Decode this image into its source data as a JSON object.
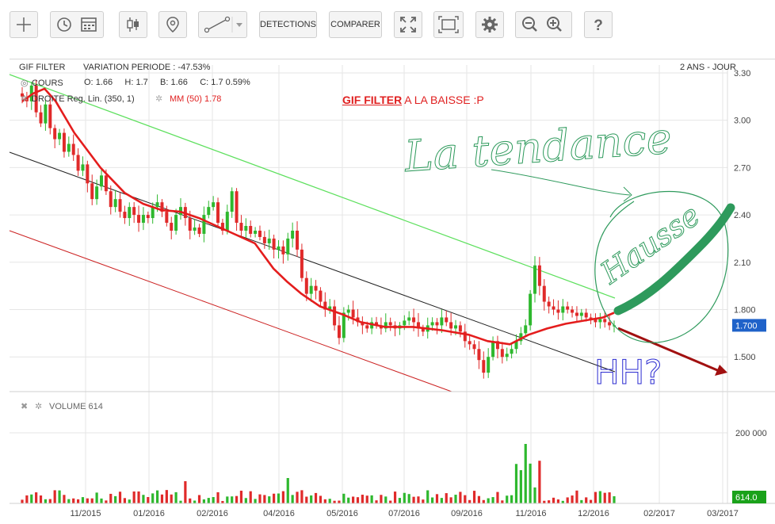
{
  "toolbar": {
    "detections_label": "DETECTIONS",
    "comparer_label": "COMPARER"
  },
  "header": {
    "instrument": "GIF FILTER",
    "variation_label": "VARIATION PERIODE :",
    "variation_value": "-47.53%",
    "period": "2 ANS - JOUR",
    "cours_label": "COURS",
    "o_label": "O:",
    "o_value": "1.66",
    "h_label": "H:",
    "h_value": "1.7",
    "b_label": "B:",
    "b_value": "1.66",
    "c_label": "C:",
    "c_value": "1.7 0.59%",
    "droite_label": "DROITE",
    "droite_value": "Reg. Lin. (350, 1)",
    "mm_label": "MM (50)",
    "mm_value": "1.78"
  },
  "annotation": {
    "title_bold": "GIF FILTER",
    "title_rest": " A LA BAISSE  :P",
    "handwritten_1": "La tendance",
    "handwritten_2": "Hausse",
    "handwritten_3": "HH?"
  },
  "volume": {
    "label": "VOLUME",
    "value": "614"
  },
  "colors": {
    "up": "#2eb82e",
    "down": "#e02a2a",
    "ma": "#e41d1d",
    "upper_channel": "#5ee05e",
    "lower_channel": "#cc2222",
    "regression": "#222222",
    "price_badge": "#1f62c9",
    "volume_badge": "#1aa21a",
    "handwriting": "#2e9a5c"
  },
  "chart_data": {
    "type": "candlestick",
    "x_ticks": [
      "11/2015",
      "01/2016",
      "02/2016",
      "04/2016",
      "05/2016",
      "07/2016",
      "09/2016",
      "11/2016",
      "12/2016",
      "02/2017",
      "03/2017"
    ],
    "y_ticks": [
      "3.30",
      "3.00",
      "2.70",
      "2.40",
      "2.10",
      "1.800",
      "1.500"
    ],
    "ylim": [
      1.28,
      3.35
    ],
    "last_price": "1.700",
    "last_volume": "614.0",
    "volume_ticks": [
      "200 000"
    ],
    "ma50_path": [
      [
        0,
        3.12
      ],
      [
        6,
        3.17
      ],
      [
        12,
        3.2
      ],
      [
        18,
        3.12
      ],
      [
        28,
        2.92
      ],
      [
        42,
        2.7
      ],
      [
        55,
        2.54
      ],
      [
        65,
        2.47
      ],
      [
        75,
        2.43
      ],
      [
        85,
        2.42
      ],
      [
        95,
        2.38
      ],
      [
        110,
        2.3
      ],
      [
        125,
        2.22
      ],
      [
        135,
        2.06
      ],
      [
        142,
        1.98
      ],
      [
        150,
        1.9
      ],
      [
        160,
        1.82
      ],
      [
        172,
        1.77
      ],
      [
        182,
        1.72
      ],
      [
        195,
        1.69
      ],
      [
        210,
        1.69
      ],
      [
        225,
        1.67
      ],
      [
        240,
        1.64
      ],
      [
        250,
        1.6
      ],
      [
        262,
        1.58
      ],
      [
        272,
        1.64
      ],
      [
        282,
        1.68
      ],
      [
        292,
        1.71
      ],
      [
        302,
        1.73
      ],
      [
        312,
        1.75
      ],
      [
        318,
        1.78
      ]
    ],
    "candles": [
      {
        "c": 3.15
      },
      {
        "c": 3.12
      },
      {
        "c": 3.22
      },
      {
        "c": 3.05
      },
      {
        "c": 2.98
      },
      {
        "c": 3.1
      },
      {
        "c": 2.95
      },
      {
        "c": 2.88
      },
      {
        "c": 2.92
      },
      {
        "c": 2.8
      },
      {
        "c": 2.85
      },
      {
        "c": 2.78
      },
      {
        "c": 2.68
      },
      {
        "c": 2.72
      },
      {
        "c": 2.6
      },
      {
        "c": 2.5
      },
      {
        "c": 2.58
      },
      {
        "c": 2.65
      },
      {
        "c": 2.55
      },
      {
        "c": 2.45
      },
      {
        "c": 2.5
      },
      {
        "c": 2.42
      },
      {
        "c": 2.38
      },
      {
        "c": 2.45
      },
      {
        "c": 2.4
      },
      {
        "c": 2.35
      },
      {
        "c": 2.4
      },
      {
        "c": 2.38
      },
      {
        "c": 2.45
      },
      {
        "c": 2.48
      },
      {
        "c": 2.42
      },
      {
        "c": 2.35
      },
      {
        "c": 2.3
      },
      {
        "c": 2.4
      },
      {
        "c": 2.45
      },
      {
        "c": 2.38
      },
      {
        "c": 2.3
      },
      {
        "c": 2.32
      },
      {
        "c": 2.28
      },
      {
        "c": 2.4
      },
      {
        "c": 2.45
      },
      {
        "c": 2.48
      },
      {
        "c": 2.35
      },
      {
        "c": 2.3
      },
      {
        "c": 2.42
      },
      {
        "c": 2.55
      },
      {
        "c": 2.35
      },
      {
        "c": 2.3
      },
      {
        "c": 2.33
      },
      {
        "c": 2.28
      },
      {
        "c": 2.3
      },
      {
        "c": 2.26
      },
      {
        "c": 2.22
      },
      {
        "c": 2.25
      },
      {
        "c": 2.18
      },
      {
        "c": 2.2
      },
      {
        "c": 2.15
      },
      {
        "c": 2.25
      },
      {
        "c": 2.3
      },
      {
        "c": 2.18
      },
      {
        "c": 2.0
      },
      {
        "c": 1.9
      },
      {
        "c": 1.95
      },
      {
        "c": 1.92
      },
      {
        "c": 1.85
      },
      {
        "c": 1.8
      },
      {
        "c": 1.82
      },
      {
        "c": 1.7
      },
      {
        "c": 1.62
      },
      {
        "c": 1.78
      },
      {
        "c": 1.8
      },
      {
        "c": 1.75
      },
      {
        "c": 1.72
      },
      {
        "c": 1.7
      },
      {
        "c": 1.68
      },
      {
        "c": 1.72
      },
      {
        "c": 1.7
      },
      {
        "c": 1.68
      },
      {
        "c": 1.72
      },
      {
        "c": 1.7
      },
      {
        "c": 1.68
      },
      {
        "c": 1.7
      },
      {
        "c": 1.73
      },
      {
        "c": 1.75
      },
      {
        "c": 1.72
      },
      {
        "c": 1.68
      },
      {
        "c": 1.66
      },
      {
        "c": 1.7
      },
      {
        "c": 1.72
      },
      {
        "c": 1.7
      },
      {
        "c": 1.75
      },
      {
        "c": 1.72
      },
      {
        "c": 1.68
      },
      {
        "c": 1.7
      },
      {
        "c": 1.66
      },
      {
        "c": 1.6
      },
      {
        "c": 1.58
      },
      {
        "c": 1.55
      },
      {
        "c": 1.48
      },
      {
        "c": 1.4
      },
      {
        "c": 1.5
      },
      {
        "c": 1.6
      },
      {
        "c": 1.55
      },
      {
        "c": 1.5
      },
      {
        "c": 1.52
      },
      {
        "c": 1.55
      },
      {
        "c": 1.6
      },
      {
        "c": 1.65
      },
      {
        "c": 1.7
      },
      {
        "c": 1.9
      },
      {
        "c": 2.08
      },
      {
        "c": 1.95
      },
      {
        "c": 1.85
      },
      {
        "c": 1.82
      },
      {
        "c": 1.8
      },
      {
        "c": 1.78
      },
      {
        "c": 1.82
      },
      {
        "c": 1.8
      },
      {
        "c": 1.78
      },
      {
        "c": 1.76
      },
      {
        "c": 1.78
      },
      {
        "c": 1.75
      },
      {
        "c": 1.74
      },
      {
        "c": 1.72
      },
      {
        "c": 1.74
      },
      {
        "c": 1.72
      },
      {
        "c": 1.7
      },
      {
        "c": 1.7
      }
    ]
  }
}
